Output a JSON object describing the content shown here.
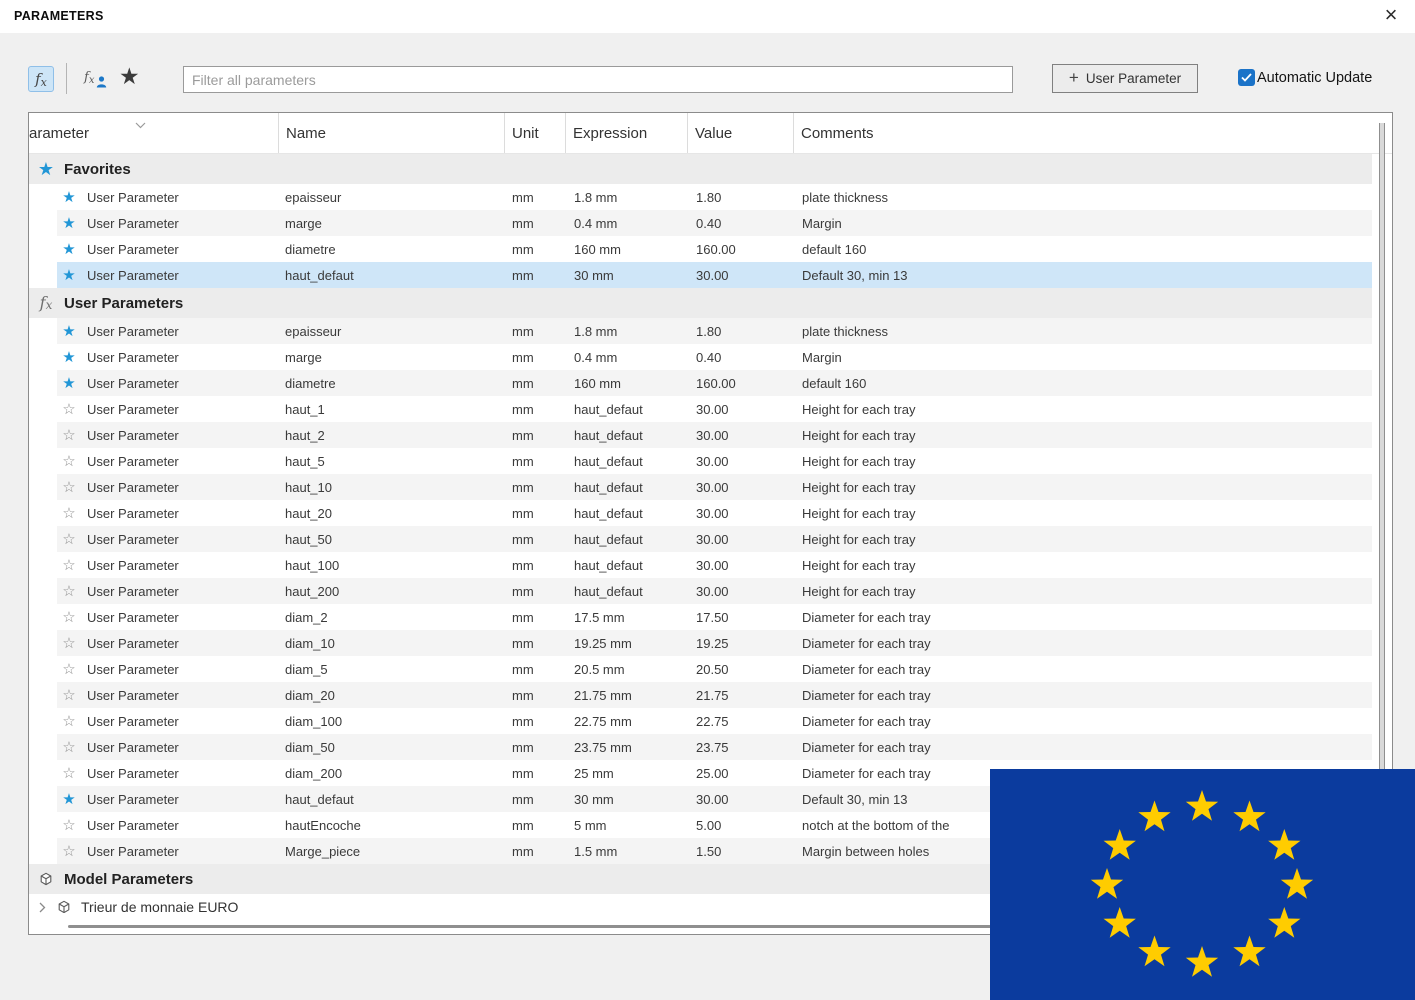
{
  "window": {
    "title": "PARAMETERS"
  },
  "icons": {
    "close": "×",
    "plus": "+",
    "fx_f": "f",
    "fx_x": "x",
    "toolbar_star": "★",
    "star_filled": "★",
    "star_outline": "☆"
  },
  "toolbar": {
    "filter_placeholder": "Filter all parameters",
    "add_user_parameter_label": "User Parameter",
    "automatic_update_label": "Automatic Update",
    "automatic_update_checked": true
  },
  "colors": {
    "accent_blue": "#2196d6",
    "selection_blue": "#cfe6f8",
    "checkbox_blue": "#1b73c8",
    "fx_button_bg": "#cde5f7"
  },
  "table": {
    "headers": [
      "arameter",
      "Name",
      "Unit",
      "Expression",
      "Value",
      "Comments"
    ],
    "sections": [
      {
        "id": "favorites",
        "icon": "star-filled",
        "label": "Favorites",
        "rows": [
          {
            "fav": true,
            "param": "User Parameter",
            "name": "epaisseur",
            "unit": "mm",
            "expr": "1.8 mm",
            "value": "1.80",
            "comment": "plate thickness"
          },
          {
            "fav": true,
            "param": "User Parameter",
            "name": "marge",
            "unit": "mm",
            "expr": "0.4 mm",
            "value": "0.40",
            "comment": "Margin"
          },
          {
            "fav": true,
            "param": "User Parameter",
            "name": "diametre",
            "unit": "mm",
            "expr": "160 mm",
            "value": "160.00",
            "comment": "default 160"
          },
          {
            "fav": true,
            "param": "User Parameter",
            "name": "haut_defaut",
            "unit": "mm",
            "expr": "30 mm",
            "value": "30.00",
            "comment": "Default 30, min 13",
            "selected": true
          }
        ]
      },
      {
        "id": "user-parameters",
        "icon": "fx",
        "label": "User Parameters",
        "rows": [
          {
            "fav": true,
            "param": "User Parameter",
            "name": "epaisseur",
            "unit": "mm",
            "expr": "1.8 mm",
            "value": "1.80",
            "comment": "plate thickness"
          },
          {
            "fav": true,
            "param": "User Parameter",
            "name": "marge",
            "unit": "mm",
            "expr": "0.4 mm",
            "value": "0.40",
            "comment": "Margin"
          },
          {
            "fav": true,
            "param": "User Parameter",
            "name": "diametre",
            "unit": "mm",
            "expr": "160 mm",
            "value": "160.00",
            "comment": "default 160"
          },
          {
            "fav": false,
            "param": "User Parameter",
            "name": "haut_1",
            "unit": "mm",
            "expr": "haut_defaut",
            "value": "30.00",
            "comment": "Height for each tray"
          },
          {
            "fav": false,
            "param": "User Parameter",
            "name": "haut_2",
            "unit": "mm",
            "expr": "haut_defaut",
            "value": "30.00",
            "comment": "Height for each tray"
          },
          {
            "fav": false,
            "param": "User Parameter",
            "name": "haut_5",
            "unit": "mm",
            "expr": "haut_defaut",
            "value": "30.00",
            "comment": "Height for each tray"
          },
          {
            "fav": false,
            "param": "User Parameter",
            "name": "haut_10",
            "unit": "mm",
            "expr": "haut_defaut",
            "value": "30.00",
            "comment": "Height for each tray"
          },
          {
            "fav": false,
            "param": "User Parameter",
            "name": "haut_20",
            "unit": "mm",
            "expr": "haut_defaut",
            "value": "30.00",
            "comment": "Height for each tray"
          },
          {
            "fav": false,
            "param": "User Parameter",
            "name": "haut_50",
            "unit": "mm",
            "expr": "haut_defaut",
            "value": "30.00",
            "comment": "Height for each tray"
          },
          {
            "fav": false,
            "param": "User Parameter",
            "name": "haut_100",
            "unit": "mm",
            "expr": "haut_defaut",
            "value": "30.00",
            "comment": "Height for each tray"
          },
          {
            "fav": false,
            "param": "User Parameter",
            "name": "haut_200",
            "unit": "mm",
            "expr": "haut_defaut",
            "value": "30.00",
            "comment": "Height for each tray"
          },
          {
            "fav": false,
            "param": "User Parameter",
            "name": "diam_2",
            "unit": "mm",
            "expr": "17.5 mm",
            "value": "17.50",
            "comment": "Diameter for each tray"
          },
          {
            "fav": false,
            "param": "User Parameter",
            "name": "diam_10",
            "unit": "mm",
            "expr": "19.25 mm",
            "value": "19.25",
            "comment": "Diameter for each tray"
          },
          {
            "fav": false,
            "param": "User Parameter",
            "name": "diam_5",
            "unit": "mm",
            "expr": "20.5 mm",
            "value": "20.50",
            "comment": "Diameter for each tray"
          },
          {
            "fav": false,
            "param": "User Parameter",
            "name": "diam_20",
            "unit": "mm",
            "expr": "21.75 mm",
            "value": "21.75",
            "comment": "Diameter for each tray"
          },
          {
            "fav": false,
            "param": "User Parameter",
            "name": "diam_100",
            "unit": "mm",
            "expr": "22.75 mm",
            "value": "22.75",
            "comment": "Diameter for each tray"
          },
          {
            "fav": false,
            "param": "User Parameter",
            "name": "diam_50",
            "unit": "mm",
            "expr": "23.75 mm",
            "value": "23.75",
            "comment": "Diameter for each tray"
          },
          {
            "fav": false,
            "param": "User Parameter",
            "name": "diam_200",
            "unit": "mm",
            "expr": "25 mm",
            "value": "25.00",
            "comment": "Diameter for each tray"
          },
          {
            "fav": true,
            "param": "User Parameter",
            "name": "haut_defaut",
            "unit": "mm",
            "expr": "30 mm",
            "value": "30.00",
            "comment": "Default 30, min 13"
          },
          {
            "fav": false,
            "param": "User Parameter",
            "name": "hautEncoche",
            "unit": "mm",
            "expr": "5 mm",
            "value": "5.00",
            "comment": "notch at the bottom of the"
          },
          {
            "fav": false,
            "param": "User Parameter",
            "name": "Marge_piece",
            "unit": "mm",
            "expr": "1.5 mm",
            "value": "1.50",
            "comment": "Margin between holes"
          }
        ]
      },
      {
        "id": "model-parameters",
        "icon": "cube",
        "label": "Model Parameters",
        "rows": [],
        "children": [
          {
            "label": "Trieur de monnaie EURO"
          }
        ]
      }
    ]
  },
  "flag": {
    "field_color": "#0b3b9e",
    "star_color": "#ffcc00",
    "star_count": 12
  }
}
